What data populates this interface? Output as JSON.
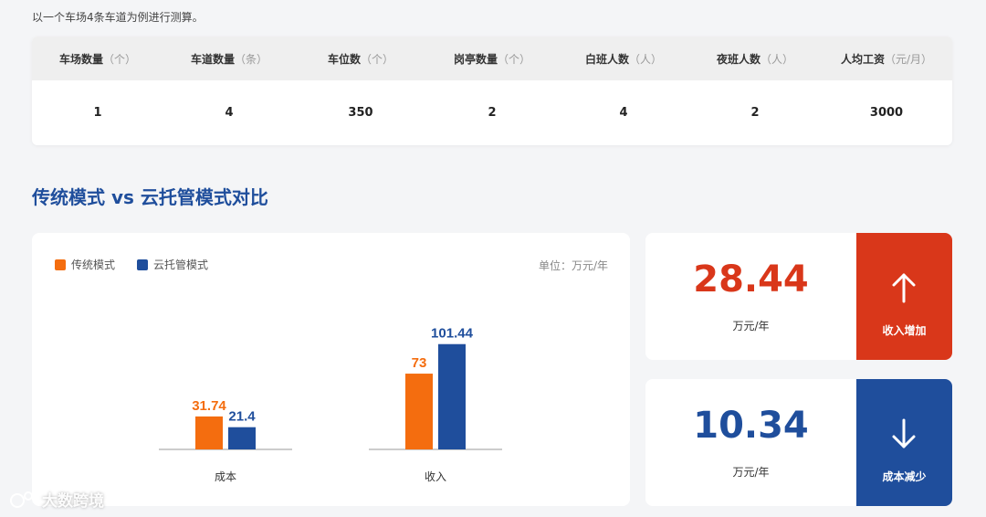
{
  "intro": "以一个车场4条车道为例进行测算。",
  "table": {
    "headers": [
      {
        "label": "车场数量",
        "unit": "（个）"
      },
      {
        "label": "车道数量",
        "unit": "（条）"
      },
      {
        "label": "车位数",
        "unit": "（个）"
      },
      {
        "label": "岗亭数量",
        "unit": "（个）"
      },
      {
        "label": "白班人数",
        "unit": "（人）"
      },
      {
        "label": "夜班人数",
        "unit": "（人）"
      },
      {
        "label": "人均工资",
        "unit": "（元/月）"
      }
    ],
    "values": [
      "1",
      "4",
      "350",
      "2",
      "4",
      "2",
      "3000"
    ]
  },
  "section_title": "传统模式 vs 云托管模式对比",
  "chart_unit": "单位：万元/年",
  "chart_data": {
    "type": "bar",
    "categories": [
      "成本",
      "收入"
    ],
    "series": [
      {
        "name": "传统模式",
        "values": [
          31.74,
          73
        ],
        "color": "#f46d0f"
      },
      {
        "name": "云托管模式",
        "values": [
          21.4,
          101.44
        ],
        "color": "#1f4e9c"
      }
    ],
    "ylim": [
      0,
      110
    ],
    "grid": false,
    "legend_position": "top-left"
  },
  "stats": {
    "increase": {
      "value": "28.44",
      "unit": "万元/年",
      "label": "收入增加",
      "color": "#d9371a",
      "icon": "arrow-up-icon"
    },
    "decrease": {
      "value": "10.34",
      "unit": "万元/年",
      "label": "成本减少",
      "color": "#1f4e9c",
      "icon": "arrow-down-icon"
    }
  },
  "watermark": "大数跨境"
}
